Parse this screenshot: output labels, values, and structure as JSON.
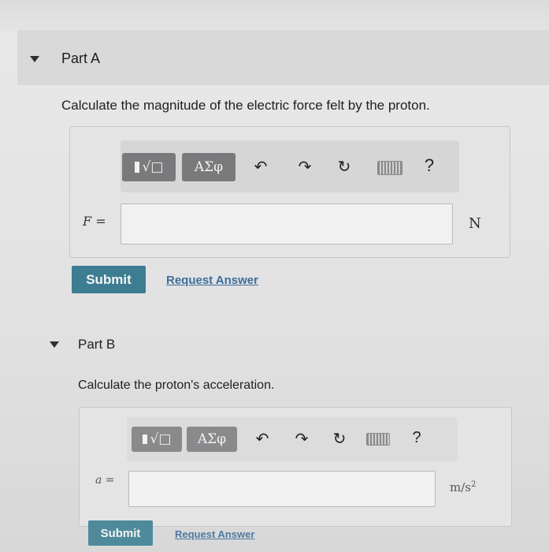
{
  "partA": {
    "title": "Part A",
    "question": "Calculate the magnitude of the electric force felt by the proton.",
    "toolbar": {
      "templates_label": "√□",
      "symbols_label": "ΑΣφ",
      "undo": "↶",
      "redo": "↷",
      "reset": "↻",
      "help": "?"
    },
    "variable": "F =",
    "input_value": "",
    "unit": "N",
    "submit_label": "Submit",
    "request_label": "Request Answer"
  },
  "partB": {
    "title": "Part B",
    "question": "Calculate the proton's acceleration.",
    "toolbar": {
      "templates_label": "√□",
      "symbols_label": "ΑΣφ",
      "undo": "↶",
      "redo": "↷",
      "reset": "↻",
      "help": "?"
    },
    "variable": "a =",
    "input_value": "",
    "unit_base": "m/s",
    "unit_exp": "2",
    "submit_label": "Submit",
    "request_label": "Request Answer"
  },
  "colors": {
    "submit_bg": "#3d7d92",
    "link": "#3e6e9a",
    "toolbar_button": "#7a7a7c"
  }
}
